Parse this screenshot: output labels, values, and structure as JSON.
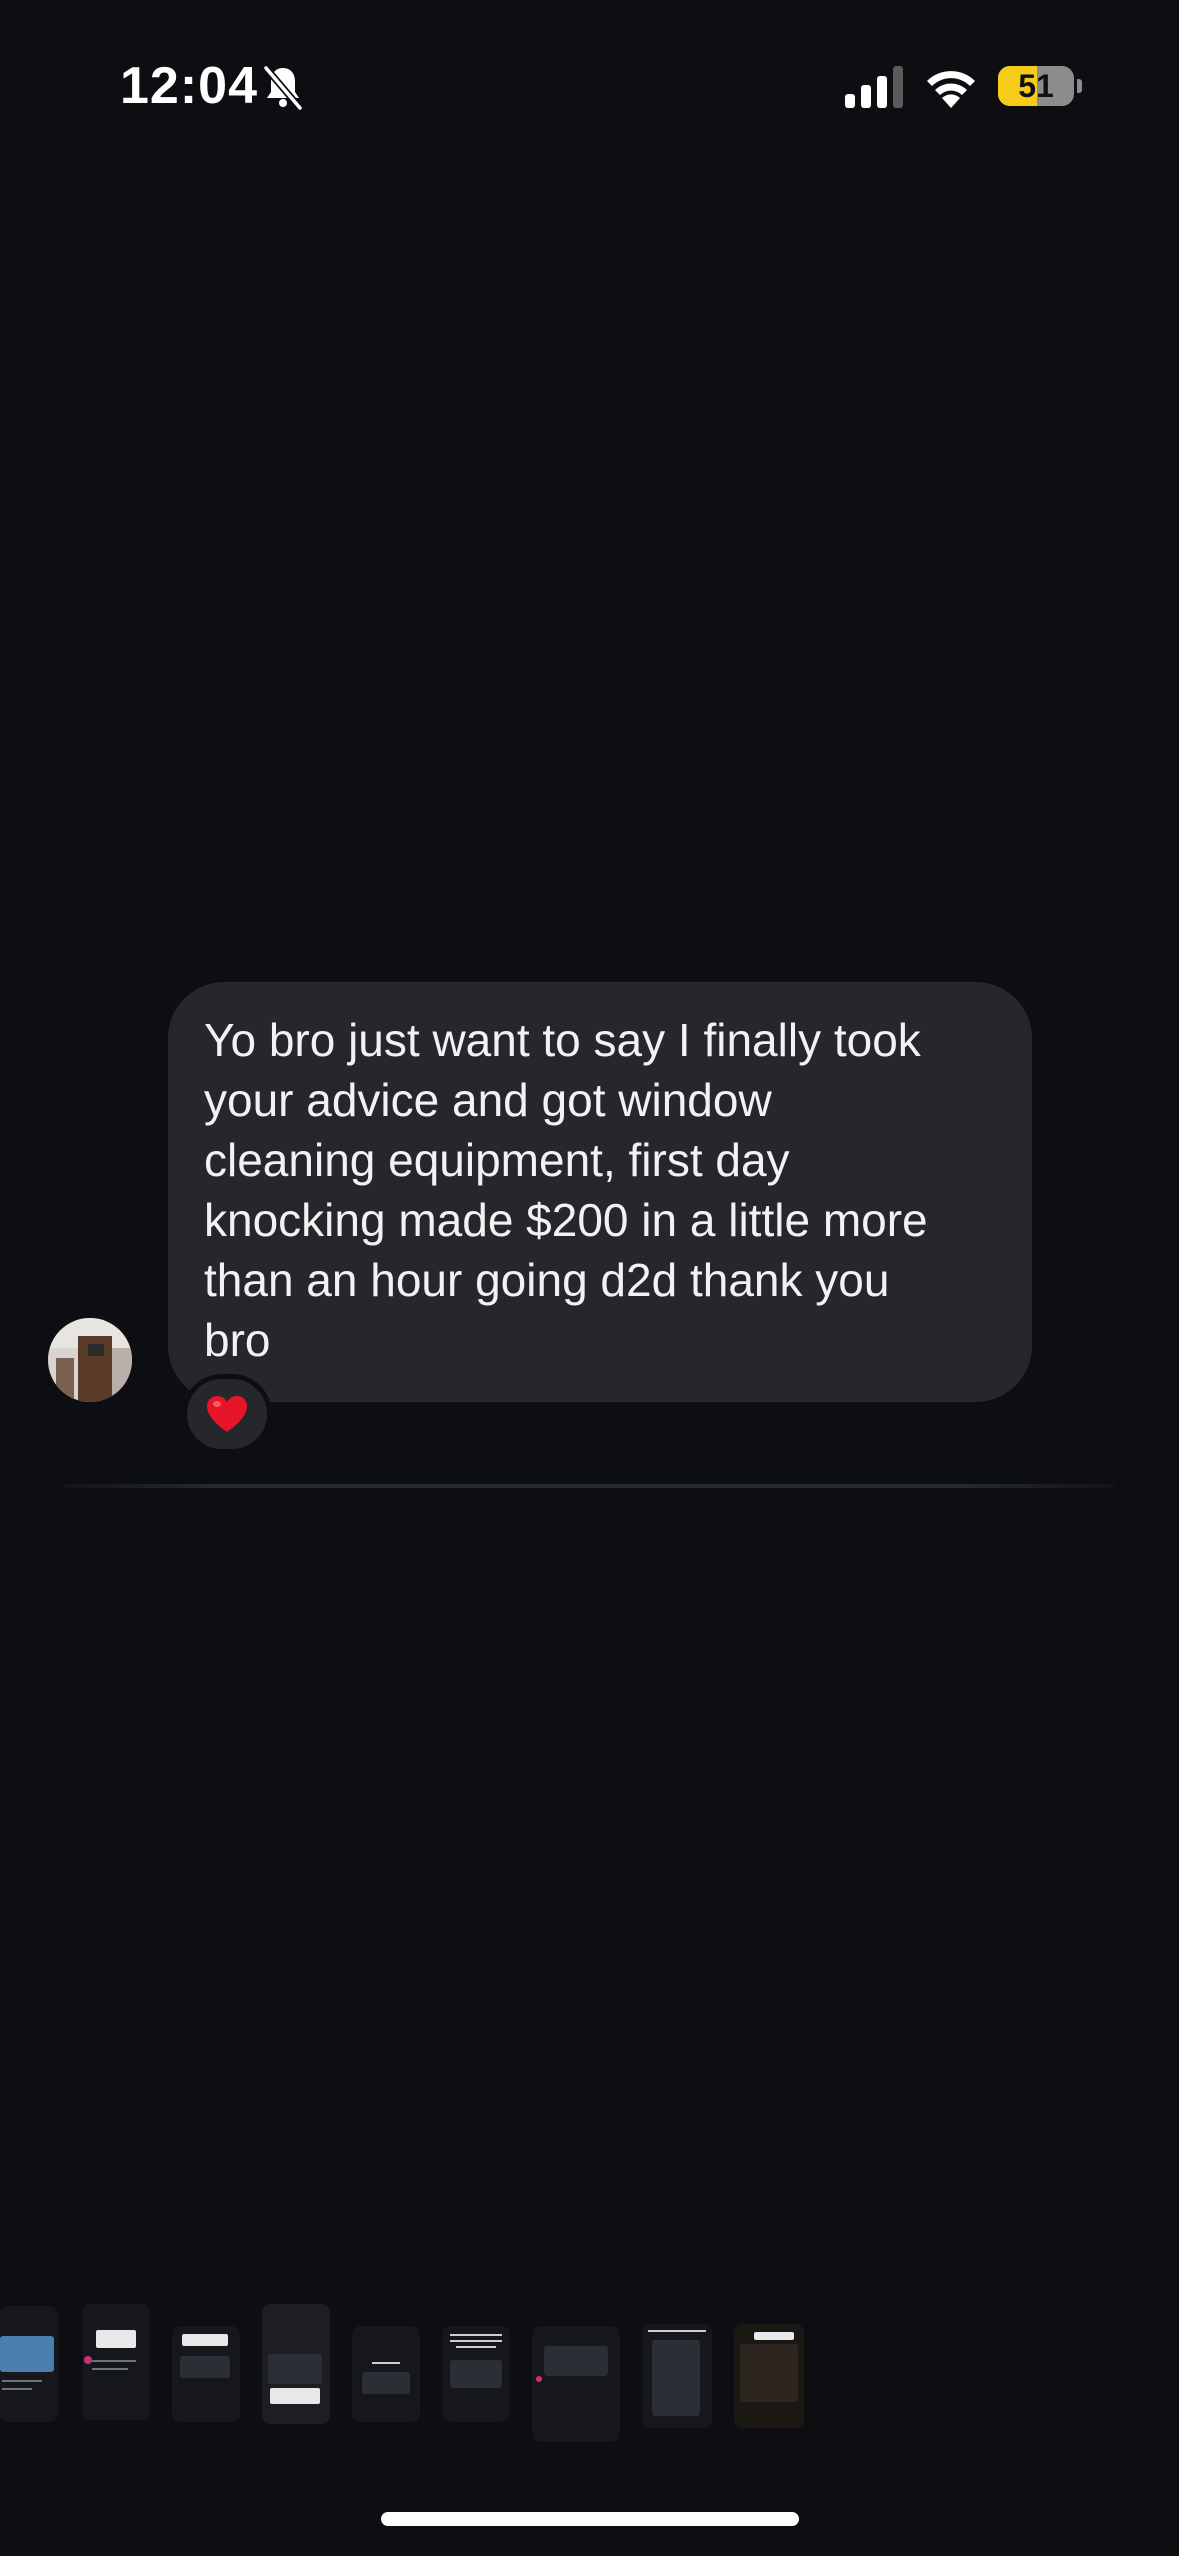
{
  "status_bar": {
    "time": "12:04",
    "silent_icon": "bell-slash-icon",
    "signal_icon": "cellular-signal-icon",
    "wifi_icon": "wifi-icon",
    "battery_level": "51",
    "battery_fraction": 0.51,
    "battery_color": "#f5cc1a"
  },
  "message": {
    "text": "Yo bro just want to say I finally took\nyour advice and got window\ncleaning equipment, first day\nknocking made $200 in a little more\nthan an hour going d2d thank you\nbro",
    "reaction": "❤️",
    "avatar_icon": "profile-avatar"
  },
  "thumbnail_strip": {
    "count": 9
  }
}
